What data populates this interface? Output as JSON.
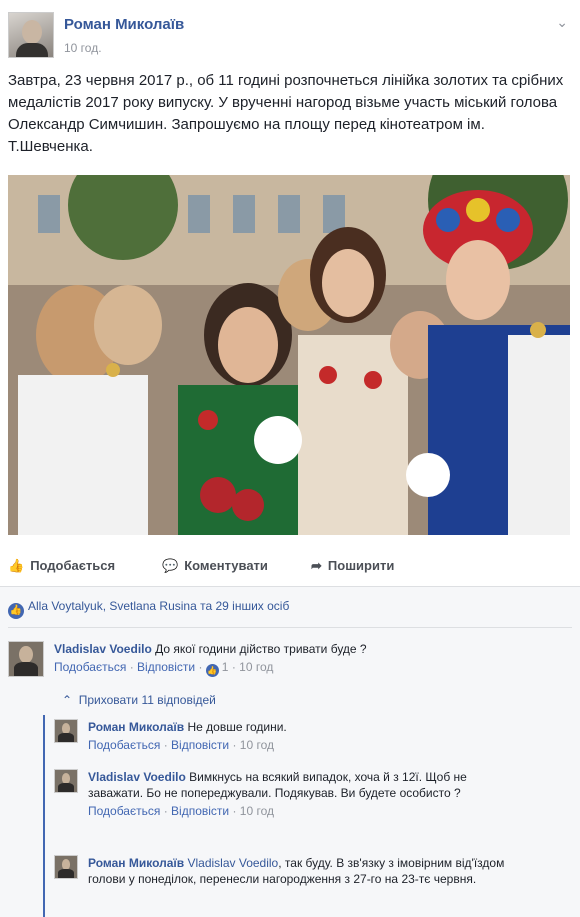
{
  "post": {
    "author": "Роман Миколаїв",
    "time": "10 год.",
    "text": "Завтра, 23 червня 2017 р., об 11 годині розпочнеться лінійка золотих та срібних медалістів 2017 року випуску. У врученні нагород візьме участь міський голова Олександр Симчишин. Запрошуємо на площу перед кінотеатром ім. Т.Шевченка.",
    "photo_icon": "photo-of-students-with-medals"
  },
  "actions": {
    "like": "Подобається",
    "comment": "Коментувати",
    "share": "Поширити"
  },
  "reactions": {
    "summary": "Alla Voytalyuk, Svetlana Rusina та 29 інших осіб"
  },
  "comments": [
    {
      "author": "Vladislav Voedilo",
      "text": "До якої години дійство тривати буде ?",
      "like": "Подобається",
      "reply": "Відповісти",
      "likes_count": "1",
      "time": "10 год"
    }
  ],
  "hide_replies": "Приховати 11 відповідей",
  "replies": [
    {
      "author": "Роман Миколаїв",
      "text": "Не довше години.",
      "like": "Подобається",
      "reply": "Відповісти",
      "time": "10 год"
    },
    {
      "author": "Vladislav Voedilo",
      "text": "Вимкнусь на всякий випадок, хоча й з 12ї. Щоб не заважати. Бо не попереджували. Подякував. Ви будете особисто ?",
      "like": "Подобається",
      "reply": "Відповісти",
      "time": "10 год"
    },
    {
      "author": "Роман Миколаїв",
      "tag": "Vladislav Voedilo",
      "text": ", так буду. В зв'язку з імовірним від'їздом голови у понеділок, перенесли нагородження з 27-го на 23-тє червня."
    }
  ],
  "colors": {
    "link": "#365899",
    "meta": "#90949c",
    "accent": "#4267b2"
  }
}
